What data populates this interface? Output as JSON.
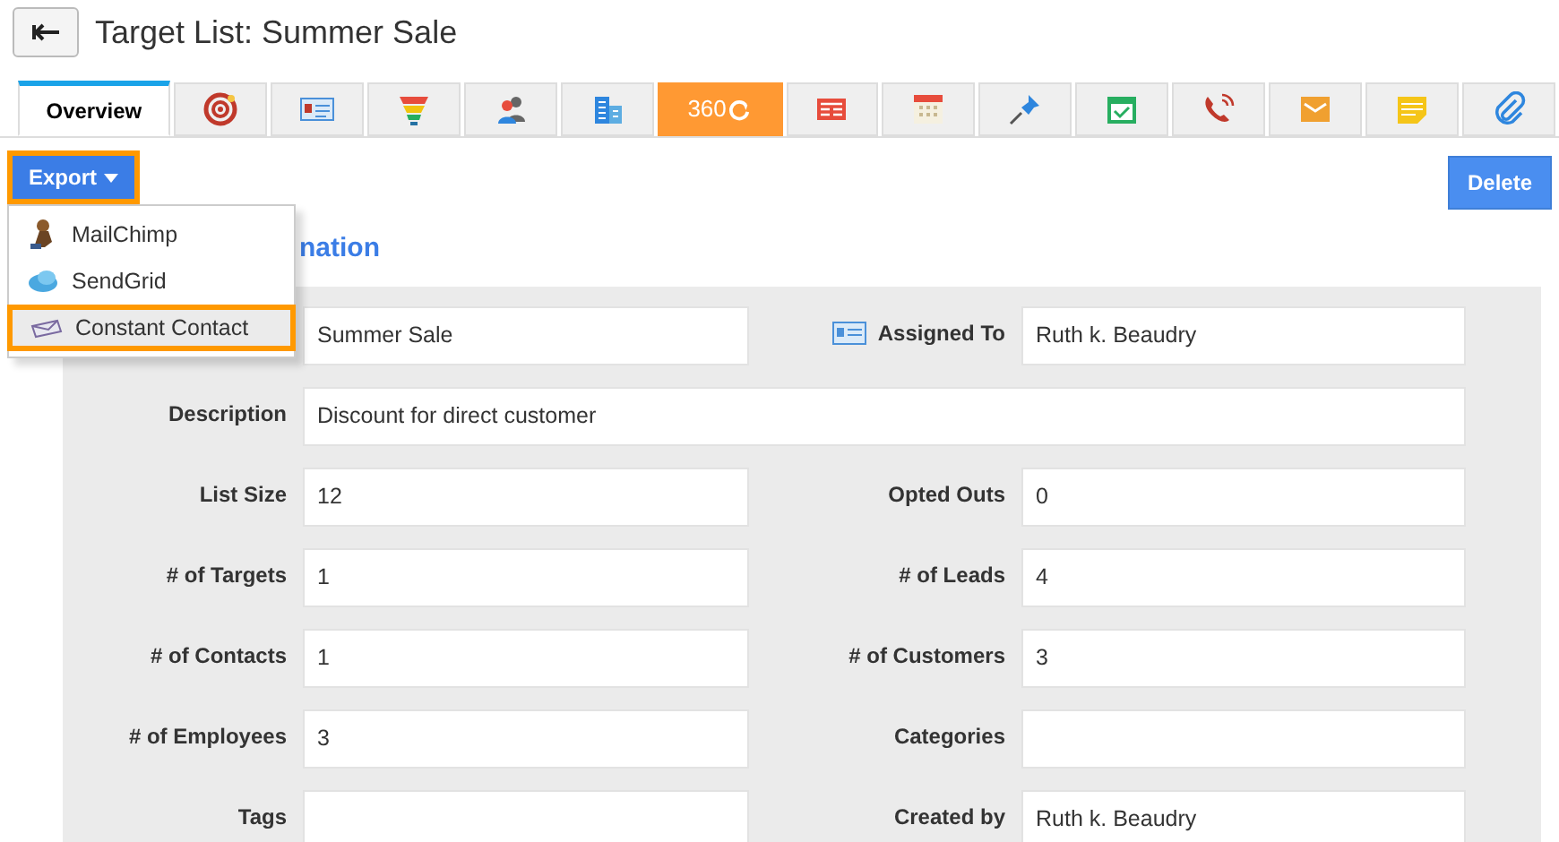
{
  "header": {
    "title": "Target List: Summer Sale"
  },
  "tabs": [
    {
      "kind": "text",
      "label": "Overview",
      "selected": true
    },
    {
      "kind": "icon",
      "selected": false
    },
    {
      "kind": "icon",
      "selected": false
    },
    {
      "kind": "icon",
      "selected": false
    },
    {
      "kind": "icon",
      "selected": false
    },
    {
      "kind": "icon",
      "selected": false
    },
    {
      "kind": "badge",
      "label": "360",
      "selected": false
    },
    {
      "kind": "icon",
      "selected": false
    },
    {
      "kind": "icon",
      "selected": false
    },
    {
      "kind": "icon",
      "selected": false
    },
    {
      "kind": "icon",
      "selected": false
    },
    {
      "kind": "icon",
      "selected": false
    },
    {
      "kind": "icon",
      "selected": false
    },
    {
      "kind": "icon",
      "selected": false
    },
    {
      "kind": "icon",
      "selected": false
    }
  ],
  "export_button": {
    "label": "Export"
  },
  "export_menu": [
    {
      "label": "MailChimp",
      "selected": false
    },
    {
      "label": "SendGrid",
      "selected": false
    },
    {
      "label": "Constant Contact",
      "selected": true
    }
  ],
  "delete_button": {
    "label": "Delete"
  },
  "section_title": "nation",
  "fields": [
    {
      "value": "Summer Sale"
    },
    {
      "label": "Assigned To",
      "value": "Ruth k. Beaudry",
      "icon": true
    },
    {
      "label": "Description",
      "value": "Discount for direct customer",
      "wide": true
    },
    {
      "label": "List Size",
      "value": "12"
    },
    {
      "label": "Opted Outs",
      "value": "0"
    },
    {
      "label": "# of Targets",
      "value": "1"
    },
    {
      "label": "# of Leads",
      "value": "4"
    },
    {
      "label": "# of Contacts",
      "value": "1"
    },
    {
      "label": "# of Customers",
      "value": "3"
    },
    {
      "label": "# of Employees",
      "value": "3"
    },
    {
      "label": "Categories"
    },
    {
      "label": "Tags"
    },
    {
      "label": "Created by",
      "value": "Ruth k. Beaudry"
    }
  ]
}
